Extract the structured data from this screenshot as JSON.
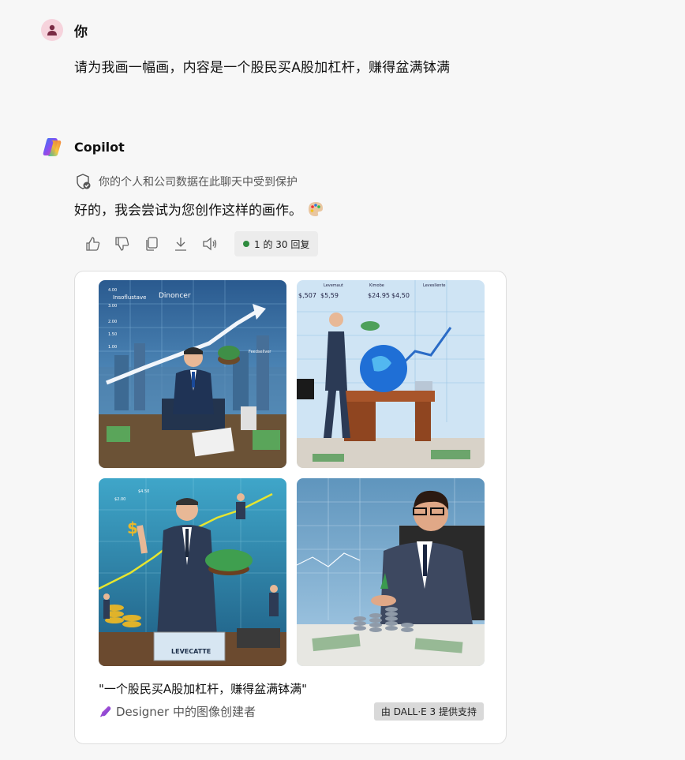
{
  "user": {
    "name": "你",
    "message": "请为我画一幅画，内容是一个股民买A股加杠杆，赚得盆满钵满"
  },
  "copilot": {
    "name": "Copilot",
    "protection_notice": "你的个人和公司数据在此聊天中受到保护",
    "reply": "好的，我会尝试为您创作这样的画作。",
    "reply_count": "1 的 30 回复",
    "actions": [
      "like-icon",
      "dislike-icon",
      "copy-icon",
      "download-icon",
      "read-aloud-icon"
    ]
  },
  "card": {
    "images": [
      {
        "labels": [
          "Insoflustave",
          "Dinoncer",
          "Feedsellver",
          "4.00",
          "3.00",
          "2.00",
          "1.50",
          "1.00"
        ]
      },
      {
        "labels": [
          "$,507",
          "$5,59",
          "$24.95",
          "$4,50",
          "Levemaut",
          "Kimobe",
          "Levesllente"
        ]
      },
      {
        "labels": [
          "$4.50",
          "$2.00",
          "LEVECATTE"
        ]
      },
      {
        "labels": []
      }
    ],
    "caption": "\"一个股民买A股加杠杆，赚得盆满钵满\"",
    "designer": "Designer 中的图像创建者",
    "powered_by": "由 DALL·E 3 提供支持"
  },
  "colors": {
    "dot": "#2e8b3e",
    "avatar_bg": "#f6d3dc",
    "card_border": "#dedede"
  }
}
